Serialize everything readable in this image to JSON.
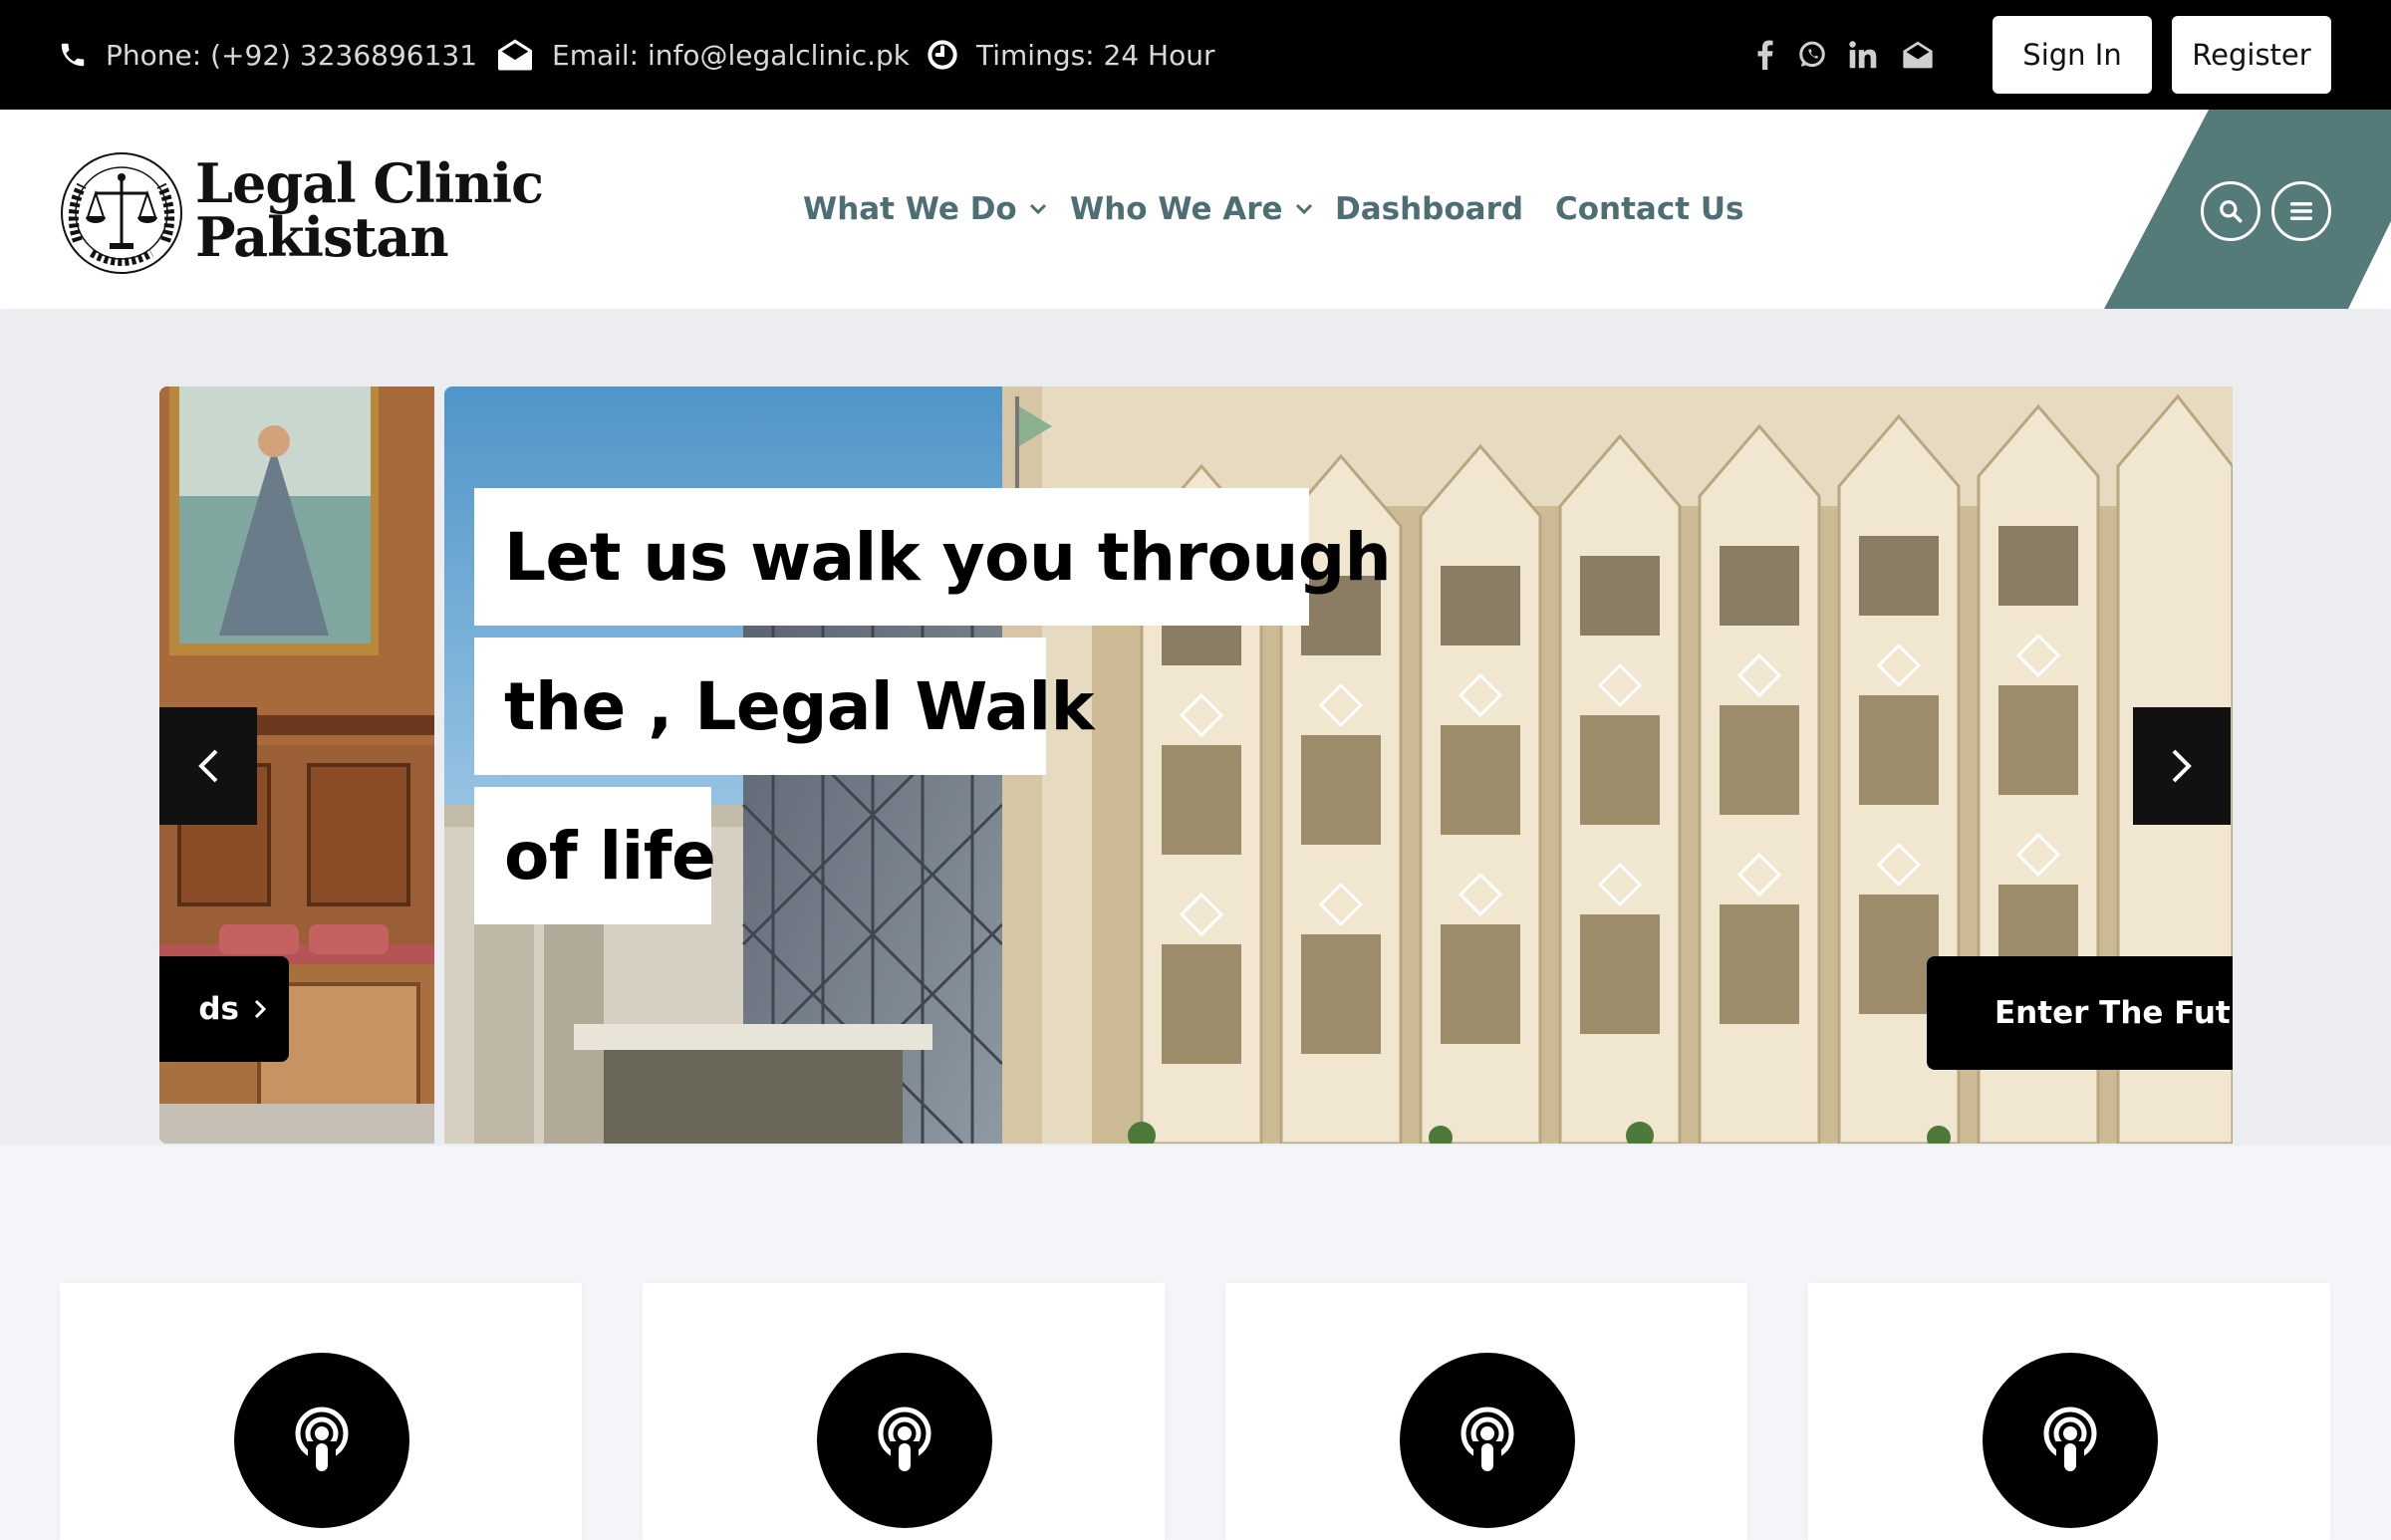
{
  "topbar": {
    "phone": "Phone: (+92) 3236896131",
    "email": "Email: info@legalclinic.pk",
    "timings": "Timings: 24 Hour",
    "social_icons": [
      "facebook-icon",
      "whatsapp-icon",
      "linkedin-icon",
      "mail-icon"
    ],
    "signin_label": "Sign In",
    "register_label": "Register"
  },
  "header": {
    "logo_line1": "Legal Clinic",
    "logo_line2": "Pakistan",
    "nav": [
      {
        "label": "What We Do",
        "dropdown": true
      },
      {
        "label": "Who We Are",
        "dropdown": true
      },
      {
        "label": "Dashboard",
        "dropdown": false
      },
      {
        "label": "Contact Us",
        "dropdown": false
      }
    ],
    "action_icons": [
      "search-icon",
      "menu-icon"
    ]
  },
  "hero": {
    "headline_lines": [
      "Let us walk you through",
      "the , Legal Walk",
      "of life"
    ],
    "prev_slide_button": "ds",
    "next_slide_button": "Enter The Future"
  },
  "features": {
    "cards": [
      {
        "icon": "podcast-icon"
      },
      {
        "icon": "podcast-icon"
      },
      {
        "icon": "podcast-icon"
      },
      {
        "icon": "podcast-icon"
      }
    ]
  },
  "colors": {
    "topbar_bg": "#000000",
    "nav_text": "#4d6e72",
    "accent_teal": "#557a7a",
    "hero_bg": "#ebedf1",
    "page_bg": "#f3f5f8"
  }
}
